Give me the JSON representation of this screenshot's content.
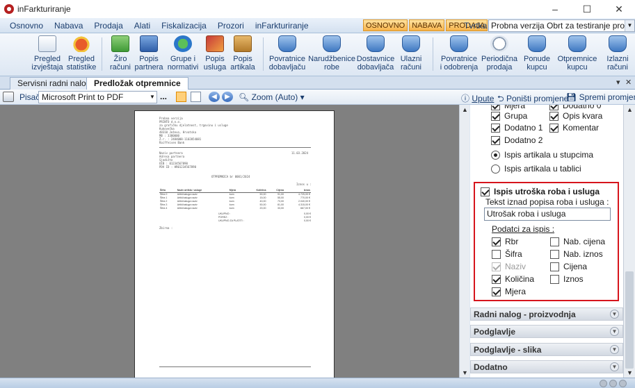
{
  "app": {
    "title": "inFarkturiranje"
  },
  "window": {
    "minimize": "–",
    "maximize": "☐",
    "close": "✕"
  },
  "menu": {
    "items": [
      "Osnovno",
      "Nabava",
      "Prodaja",
      "Alati",
      "Fiskalizacija",
      "Prozori",
      "inFarkturiranje"
    ],
    "tags": [
      "OSNOVNO",
      "NABAVA",
      "PRODAJA"
    ],
    "firm_label": "Tvrtka :",
    "firm_value": "Probna verzija Obrt za testiranje programa"
  },
  "ribbon": {
    "buttons": [
      {
        "line1": "Pregled",
        "line2": "izvještaja",
        "icon": "report-icon"
      },
      {
        "line1": "Pregled",
        "line2": "statistike",
        "icon": "pie-chart-icon"
      },
      {
        "line1": "Žiro",
        "line2": "računi",
        "icon": "bank-plus-icon"
      },
      {
        "line1": "Popis",
        "line2": "partnera",
        "icon": "people-icon"
      },
      {
        "line1": "Grupe i",
        "line2": "normativi",
        "icon": "globe-icon"
      },
      {
        "line1": "Popis",
        "line2": "usluga",
        "icon": "tools-icon"
      },
      {
        "line1": "Popis",
        "line2": "artikala",
        "icon": "box-icon"
      },
      {
        "line1": "Povratnice",
        "line2": "dobavljaču",
        "icon": "document-stack-icon"
      },
      {
        "line1": "Narudžbenice",
        "line2": "robe",
        "icon": "document-stack-icon"
      },
      {
        "line1": "Dostavnice",
        "line2": "dobavljača",
        "icon": "document-stack-icon"
      },
      {
        "line1": "Ulazni",
        "line2": "računi",
        "icon": "document-stack-icon"
      },
      {
        "line1": "Povratnice",
        "line2": "i odobrenja",
        "icon": "document-stack-icon"
      },
      {
        "line1": "Periodična",
        "line2": "prodaja",
        "icon": "clock-icon"
      },
      {
        "line1": "Ponude",
        "line2": "kupcu",
        "icon": "document-stack-icon"
      },
      {
        "line1": "Otpremnice",
        "line2": "kupcu",
        "icon": "document-stack-icon"
      },
      {
        "line1": "Izlazni",
        "line2": "računi",
        "icon": "document-stack-icon"
      }
    ]
  },
  "tabs": {
    "items": [
      "Servisni radni nalozi",
      "Predložak otpremnice"
    ],
    "active": 1,
    "dropdown": "▾",
    "close": "✕"
  },
  "toolbar": {
    "printer_label": "Pisač",
    "printer_value": "Microsoft Print to PDF",
    "more": "...",
    "zoom": "Zoom (Auto)",
    "help": "Upute",
    "undo": "Poništi promjene",
    "save": "Spremi promjene"
  },
  "document": {
    "header_lines": [
      "Probna verzija",
      "PRINTO d.o.o.",
      "za grafičku djelatnost, trgovinu i usluge",
      "Kukovečka",
      "48310 Ježevo, Hrvatska",
      "MB : 3380000",
      "Ž.r. : 2484008-1102054081",
      "Raiffeisen Bank"
    ],
    "partner_lines": [
      "Naziv partnera",
      "Adresa partnera",
      "Sjedište",
      "OIB : 01234567890",
      "PDV ID : HR01234567890"
    ],
    "date": "11.03.2024",
    "doc_title": "OTPREMNICA br 0001/2024",
    "currency_label": "Iznos u :",
    "columns": [
      "Šifra",
      "Naziv artikla / usluge",
      "Mjera",
      "Količina",
      "Cijena",
      "Iznos"
    ],
    "rows": [
      [
        "Šifra 0",
        "Artikl/usluga naziv",
        "kom",
        "50,00",
        "91,00",
        "4.725,00 €"
      ],
      [
        "Šifra 1",
        "Artikl/usluga naziv",
        "kom",
        "15,00",
        "55,00",
        "770,00 €"
      ],
      [
        "Šifra 2",
        "Artikl/usluga naziv",
        "kom",
        "40,00",
        "73,00",
        "2.040,00 €"
      ],
      [
        "Šifra 3",
        "Artikl/usluga naziv",
        "kom",
        "50,00",
        "81,00",
        "4.315,00 €"
      ],
      [
        "Šifra 4",
        "Artikl/usluga naziv",
        "kom",
        "20,00",
        "33,00",
        "667,00 €"
      ]
    ],
    "totals": [
      {
        "label": "UKUPNO :",
        "value": "0,00 €"
      },
      {
        "label": "POREZ :",
        "value": "0,00 €"
      },
      {
        "label": "UKUPNO ZA PLATITI :",
        "value": "0,00 €"
      }
    ],
    "footer": "Zbirna :"
  },
  "panel": {
    "top_checks": [
      {
        "label": "Mjera",
        "checked": true
      },
      {
        "label": "Dodatno 0",
        "checked": true
      },
      {
        "label": "Grupa",
        "checked": true
      },
      {
        "label": "Opis kvara",
        "checked": true
      },
      {
        "label": "Dodatno 1",
        "checked": true
      },
      {
        "label": "Komentar",
        "checked": true
      },
      {
        "label": "Dodatno 2",
        "checked": true
      }
    ],
    "radios": [
      {
        "label": "Ispis artikala u stupcima",
        "checked": true
      },
      {
        "label": "Ispis artikala u tablici",
        "checked": false
      }
    ],
    "group": {
      "title": "Ispis utroška roba i usluga",
      "checked": true,
      "text_label": "Tekst iznad popisa roba i usluga :",
      "text_value": "Utrošak roba i usluga",
      "data_label": "Podatci za ispis :",
      "checks": [
        {
          "label": "Rbr",
          "checked": true,
          "disabled": false
        },
        {
          "label": "Nab. cijena",
          "checked": false,
          "disabled": false
        },
        {
          "label": "Šifra",
          "checked": false,
          "disabled": false
        },
        {
          "label": "Nab. iznos",
          "checked": false,
          "disabled": false
        },
        {
          "label": "Naziv",
          "checked": true,
          "disabled": true
        },
        {
          "label": "Cijena",
          "checked": false,
          "disabled": false
        },
        {
          "label": "Količina",
          "checked": true,
          "disabled": false
        },
        {
          "label": "Iznos",
          "checked": false,
          "disabled": false
        },
        {
          "label": "Mjera",
          "checked": true,
          "disabled": false
        }
      ]
    },
    "sections": [
      "Radni nalog - proizvodnja",
      "Podglavlje",
      "Podglavlje - slika",
      "Dodatno"
    ]
  },
  "colors": {
    "highlight_border": "#d6141c",
    "active_tag": "#f7b34a"
  }
}
